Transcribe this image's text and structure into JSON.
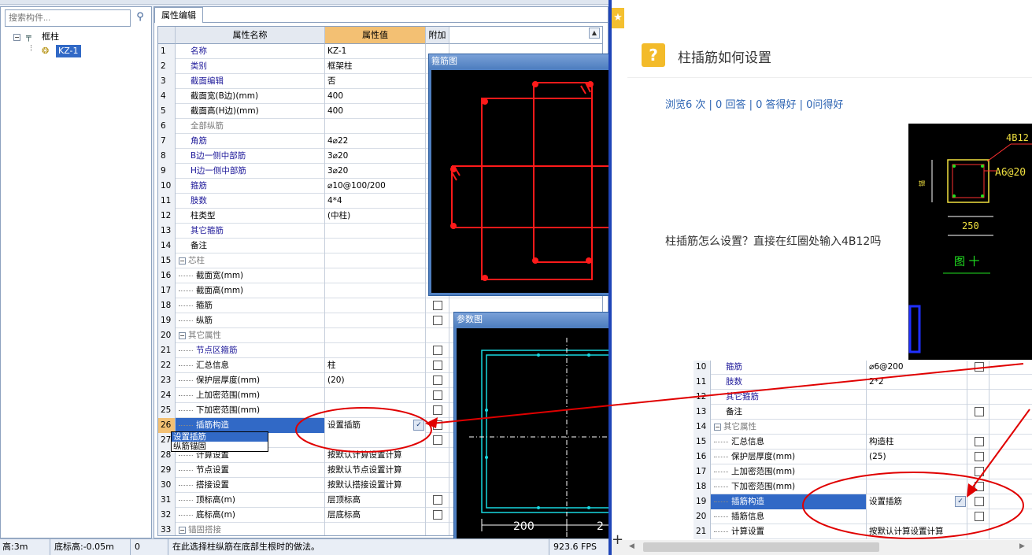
{
  "search": {
    "placeholder": "搜索构件..."
  },
  "tree": {
    "root": "框柱",
    "child": "KZ-1"
  },
  "tab": {
    "label": "属性编辑"
  },
  "grid": {
    "headers": [
      "属性名称",
      "属性值",
      "附加"
    ],
    "rows": [
      {
        "n": "1",
        "name": "名称",
        "val": "KZ-1",
        "style": "blue",
        "chk": false
      },
      {
        "n": "2",
        "name": "类别",
        "val": "框架柱",
        "style": "blue",
        "chk": false
      },
      {
        "n": "3",
        "name": "截面编辑",
        "val": "否",
        "style": "blue",
        "chk": false
      },
      {
        "n": "4",
        "name": "截面宽(B边)(mm)",
        "val": "400",
        "style": "",
        "chk": false
      },
      {
        "n": "5",
        "name": "截面高(H边)(mm)",
        "val": "400",
        "style": "",
        "chk": false
      },
      {
        "n": "6",
        "name": "全部纵筋",
        "val": "",
        "style": "gray",
        "chk": false
      },
      {
        "n": "7",
        "name": "角筋",
        "val": "4⌀22",
        "style": "blue",
        "chk": false
      },
      {
        "n": "8",
        "name": "B边一侧中部筋",
        "val": "3⌀20",
        "style": "blue",
        "chk": false
      },
      {
        "n": "9",
        "name": "H边一侧中部筋",
        "val": "3⌀20",
        "style": "blue",
        "chk": false
      },
      {
        "n": "10",
        "name": "箍筋",
        "val": "⌀10@100/200",
        "style": "blue",
        "chk": false
      },
      {
        "n": "11",
        "name": "肢数",
        "val": "4*4",
        "style": "blue",
        "chk": false
      },
      {
        "n": "12",
        "name": "柱类型",
        "val": "(中柱)",
        "style": "",
        "chk": false
      },
      {
        "n": "13",
        "name": "其它箍筋",
        "val": "",
        "style": "blue",
        "chk": false
      },
      {
        "n": "14",
        "name": "备注",
        "val": "",
        "style": "",
        "chk": false
      },
      {
        "n": "15",
        "name": "芯柱",
        "val": "",
        "style": "gray",
        "group": true,
        "chk": false
      },
      {
        "n": "16",
        "name": "截面宽(mm)",
        "val": "",
        "style": "",
        "sub": true,
        "chk": false
      },
      {
        "n": "17",
        "name": "截面高(mm)",
        "val": "",
        "style": "",
        "sub": true,
        "chk": false
      },
      {
        "n": "18",
        "name": "箍筋",
        "val": "",
        "style": "",
        "sub": true,
        "chk": true
      },
      {
        "n": "19",
        "name": "纵筋",
        "val": "",
        "style": "",
        "sub": true,
        "chk": true
      },
      {
        "n": "20",
        "name": "其它属性",
        "val": "",
        "style": "gray",
        "group": true,
        "chk": false
      },
      {
        "n": "21",
        "name": "节点区箍筋",
        "val": "",
        "style": "blue",
        "sub": true,
        "chk": true
      },
      {
        "n": "22",
        "name": "汇总信息",
        "val": "柱",
        "style": "",
        "sub": true,
        "chk": true
      },
      {
        "n": "23",
        "name": "保护层厚度(mm)",
        "val": "(20)",
        "style": "",
        "sub": true,
        "chk": true
      },
      {
        "n": "24",
        "name": "上加密范围(mm)",
        "val": "",
        "style": "",
        "sub": true,
        "chk": true
      },
      {
        "n": "25",
        "name": "下加密范围(mm)",
        "val": "",
        "style": "",
        "sub": true,
        "chk": true
      },
      {
        "n": "26",
        "name": "插筋构造",
        "val": "设置插筋",
        "style": "",
        "sub": true,
        "sel": true,
        "chk": true
      },
      {
        "n": "27",
        "name": "插筋信息",
        "val": "",
        "style": "",
        "sub": true,
        "chk": true
      },
      {
        "n": "28",
        "name": "计算设置",
        "val": "按默认计算设置计算",
        "style": "",
        "sub": true,
        "chk": false
      },
      {
        "n": "29",
        "name": "节点设置",
        "val": "按默认节点设置计算",
        "style": "",
        "sub": true,
        "chk": false
      },
      {
        "n": "30",
        "name": "搭接设置",
        "val": "按默认搭接设置计算",
        "style": "",
        "sub": true,
        "chk": false
      },
      {
        "n": "31",
        "name": "顶标高(m)",
        "val": "层顶标高",
        "style": "",
        "sub": true,
        "chk": true
      },
      {
        "n": "32",
        "name": "底标高(m)",
        "val": "层底标高",
        "style": "",
        "sub": true,
        "chk": true
      },
      {
        "n": "33",
        "name": "锚固搭接",
        "val": "",
        "style": "gray",
        "group": true,
        "chk": false
      }
    ]
  },
  "dropdown": {
    "options": [
      "设置插筋",
      "纵筋锚固"
    ]
  },
  "panes": {
    "stirrup_title": "箍筋图",
    "param_title": "参数图",
    "dim1": "200",
    "dim2": "2"
  },
  "status": {
    "top_elev": "高:3m",
    "bottom_elev": "底标高:-0.05m",
    "zero": "0",
    "hint": "在此选择柱纵筋在底部生根时的做法。",
    "fps": "923.6 FPS"
  },
  "article": {
    "title": "柱插筋如何设置",
    "stats": "浏览6 次 | 0 回答 | 0 答得好 | 0问得好",
    "question": "柱插筋怎么设置？直接在红圈处输入4B12吗",
    "cad": {
      "label1": "4B12",
      "label2": "A6@20",
      "dim": "250",
      "tag": "图 十"
    }
  },
  "shot2": {
    "rows": [
      {
        "n": "10",
        "name": "箍筋",
        "val": "⌀6@200",
        "style": "blue",
        "chk": true
      },
      {
        "n": "11",
        "name": "肢数",
        "val": "2*2",
        "style": "blue",
        "chk": false
      },
      {
        "n": "12",
        "name": "其它箍筋",
        "val": "",
        "style": "blue",
        "chk": false
      },
      {
        "n": "13",
        "name": "备注",
        "val": "",
        "style": "",
        "chk": true
      },
      {
        "n": "14",
        "name": "其它属性",
        "val": "",
        "style": "gray",
        "group": true,
        "chk": false
      },
      {
        "n": "15",
        "name": "汇总信息",
        "val": "构造柱",
        "style": "",
        "sub": true,
        "chk": true
      },
      {
        "n": "16",
        "name": "保护层厚度(mm)",
        "val": "(25)",
        "style": "",
        "sub": true,
        "chk": true
      },
      {
        "n": "17",
        "name": "上加密范围(mm)",
        "val": "",
        "style": "",
        "sub": true,
        "chk": true
      },
      {
        "n": "18",
        "name": "下加密范围(mm)",
        "val": "",
        "style": "",
        "sub": true,
        "chk": true
      },
      {
        "n": "19",
        "name": "插筋构造",
        "val": "设置插筋",
        "style": "",
        "sub": true,
        "sel": true,
        "chk": true
      },
      {
        "n": "20",
        "name": "插筋信息",
        "val": "",
        "style": "",
        "sub": true,
        "chk": true
      },
      {
        "n": "21",
        "name": "计算设置",
        "val": "按默认计算设置计算",
        "style": "",
        "sub": true,
        "chk": false
      }
    ]
  },
  "colors": {
    "accent": "#3169c6",
    "annotation": "#e00000",
    "link": "#2d64b3"
  }
}
